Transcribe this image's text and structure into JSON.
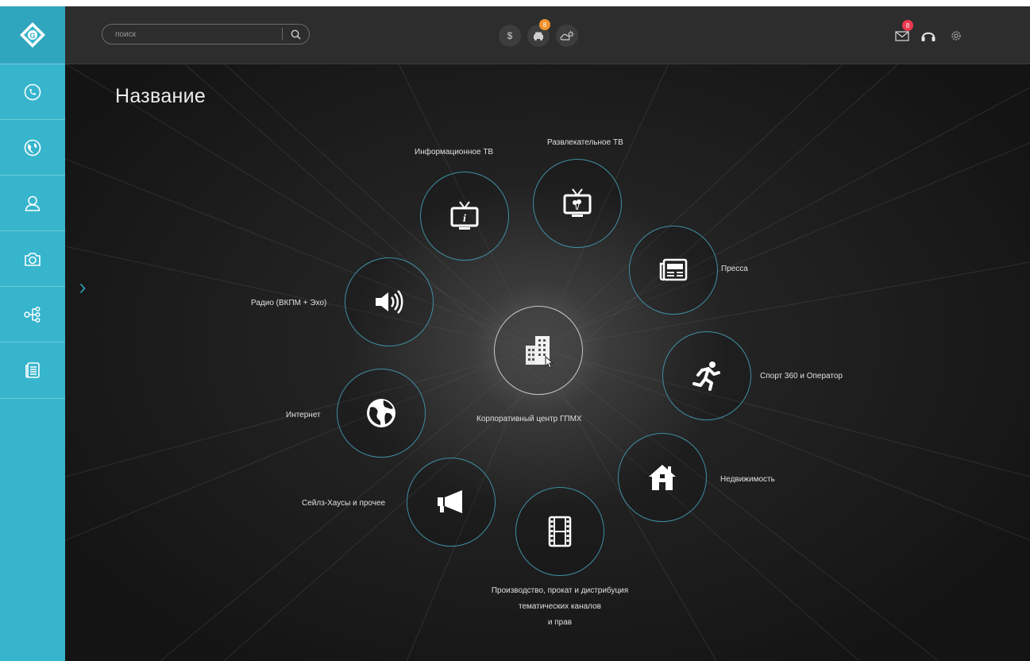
{
  "search": {
    "placeholder": "поиск"
  },
  "header": {
    "car_badge": "8",
    "mail_badge": "8",
    "dollar_symbol": "$"
  },
  "page": {
    "title": "Название"
  },
  "sidebar": {
    "items": [
      {
        "icon": "phone-icon"
      },
      {
        "icon": "globe-icon"
      },
      {
        "icon": "user-icon"
      },
      {
        "icon": "camera-icon"
      },
      {
        "icon": "structure-icon"
      },
      {
        "icon": "document-icon"
      }
    ]
  },
  "services": {
    "center": {
      "label": "Корпоративный центр ГПМХ",
      "icon": "buildings-icon"
    },
    "info_tv": {
      "label": "Информационное ТВ",
      "icon": "tv-info-icon"
    },
    "fun_tv": {
      "label": "Развлекательное ТВ",
      "icon": "tv-balloon-icon"
    },
    "press": {
      "label": "Пресса",
      "icon": "newspaper-icon"
    },
    "sport": {
      "label": "Спорт 360 и Оператор",
      "icon": "runner-icon"
    },
    "realty": {
      "label": "Недвижимость",
      "icon": "house-icon"
    },
    "production": {
      "label_lines": [
        "Производство, прокат и дистрибуция",
        "тематических каналов",
        "и прав"
      ],
      "icon": "film-icon"
    },
    "sales": {
      "label": "Сейлз-Хаусы и прочее",
      "icon": "megaphone-icon"
    },
    "internet": {
      "label": "Интернет",
      "icon": "globe-icon"
    },
    "radio": {
      "label": "Радио (ВКПМ + Эхо)",
      "icon": "speaker-icon"
    }
  },
  "colors": {
    "sidebar": "#36b5cd",
    "circle_border": "#3f8ea1",
    "badge_orange": "#f0922b",
    "badge_red": "#e8384f"
  }
}
